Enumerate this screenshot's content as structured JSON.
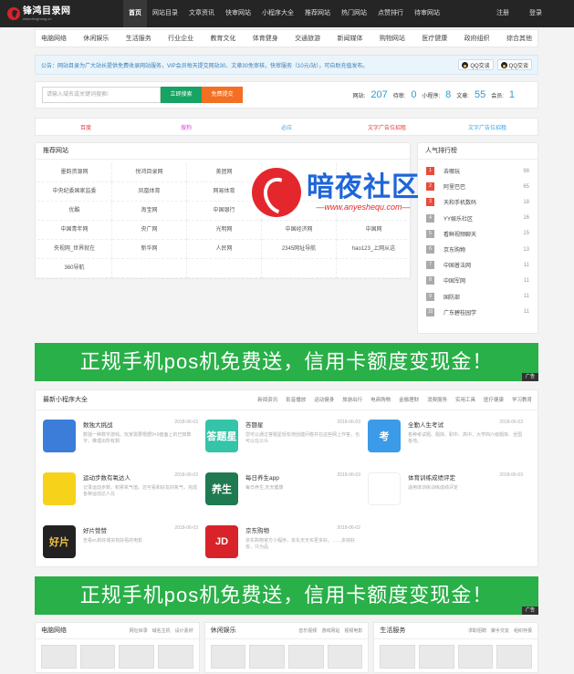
{
  "brand": {
    "name": "锋鸿目录网",
    "slogan": "www.fenghong.cn"
  },
  "nav": {
    "items": [
      "首页",
      "网站目录",
      "文章资讯",
      "快审网站",
      "小程序大全",
      "推荐网站",
      "热门网站",
      "点赞排行",
      "待审网站"
    ],
    "login": "注册",
    "register": "登录"
  },
  "categories": [
    "电脑网络",
    "休闲娱乐",
    "生活服务",
    "行业企业",
    "教育文化",
    "体育健身",
    "交通旅游",
    "新闻媒体",
    "购物网站",
    "医疗健康",
    "政府组织",
    "综合其他"
  ],
  "notice": {
    "text": "公告：网站目录为广大站长提供免费收录网站服务，VIP会员每天提交网站30、文章30免审核，快审服务（10元/站），可自助充值发布。",
    "qq1": "QQ交谈",
    "qq2": "QQ交谈"
  },
  "search": {
    "placeholder": "请输入域名或关键词搜索!",
    "btn_search": "立即搜索",
    "btn_submit": "免费提交"
  },
  "stats": {
    "site_label": "网站:",
    "site_value": "207",
    "pending_label": "待审:",
    "pending_value": "0",
    "app_label": "小程序:",
    "app_value": "8",
    "article_label": "文章:",
    "article_value": "55",
    "member_label": "会员:",
    "member_value": "1"
  },
  "ads": [
    {
      "label": "百度",
      "color": "#e33b3b"
    },
    {
      "label": "搜狗",
      "color": "#d64fd6"
    },
    {
      "label": "必应",
      "color": "#3aa3e0"
    },
    {
      "label": "文字广告位招租",
      "color": "#e33b3b"
    },
    {
      "label": "文字广告位招租",
      "color": "#3aa3e0"
    }
  ],
  "recommend": {
    "title": "推荐网站",
    "sites": [
      "墨韵资源网",
      "悦鸿目录网",
      "美团网",
      "",
      "",
      "中央纪委国家监委",
      "凤凰体育",
      "网易体育",
      "",
      "",
      "优酷",
      "淘宝网",
      "中国银行",
      "",
      "",
      "中国青年网",
      "央广网",
      "光明网",
      "中国经济网",
      "中国网",
      "央视网_世界就在",
      "新华网",
      "人民网",
      "2345网址导航",
      "hao123_上网从这",
      "360导航",
      "",
      "",
      "",
      ""
    ]
  },
  "ranking": {
    "title": "人气排行榜",
    "items": [
      {
        "n": "1",
        "t": "去哪玩",
        "c": "98"
      },
      {
        "n": "2",
        "t": "阿里巴巴",
        "c": "65"
      },
      {
        "n": "3",
        "t": "天和手机数码",
        "c": "18"
      },
      {
        "n": "4",
        "t": "YY娱乐社区",
        "c": "16"
      },
      {
        "n": "5",
        "t": "看鲜视频聊天",
        "c": "15"
      },
      {
        "n": "6",
        "t": "京东购物",
        "c": "13"
      },
      {
        "n": "7",
        "t": "中国普法网",
        "c": "11"
      },
      {
        "n": "8",
        "t": "中国军网",
        "c": "11"
      },
      {
        "n": "9",
        "t": "国防部",
        "c": "11"
      },
      {
        "n": "10",
        "t": "广东碧桂园学",
        "c": "11"
      }
    ]
  },
  "watermark": {
    "title": "暗夜社区",
    "url": "—www.anyeshequ.com—"
  },
  "banner": {
    "text": "正规手机pos机免费送，信用卡额度变现金！",
    "tag": "广告"
  },
  "mini": {
    "title": "最新小程序大全",
    "tabs": [
      "新闻资讯",
      "影音播放",
      "运动健身",
      "旅游出行",
      "电商购物",
      "金融理财",
      "消费服务",
      "实用工具",
      "医疗健康",
      "学习教育"
    ],
    "apps": [
      {
        "name": "数独大挑战",
        "date": "2018-06-03",
        "desc": "数独一种数字游戏。玩家需要根据9×9盘面上的已知数字，推理出所有剩",
        "icon": "#3c7dd9",
        "glyph": ""
      },
      {
        "name": "答题星",
        "date": "2018-06-03",
        "desc": "您可以通过答题星轻松地创建问卷并在这些网上作答，也可以在公众",
        "icon": "#35c4a8",
        "glyph": "答题星"
      },
      {
        "name": "全勤人生考试",
        "date": "2018-06-03",
        "desc": "各种考试题、题库、职中、高中、大学四六级题库、全国各地。",
        "icon": "#3b9be8",
        "glyph": "考"
      },
      {
        "name": "运动步数有氧达人",
        "date": "2018-06-03",
        "desc": "记录运动步数，积累氧气值。还可看和好友的氧气，完成各种运动达人兑",
        "icon": "#f6d21a",
        "glyph": ""
      },
      {
        "name": "每日养生app",
        "date": "2018-06-03",
        "desc": "每日养生,天天健康",
        "icon": "#1f7a52",
        "glyph": "养生"
      },
      {
        "name": "体育训练成绩评定",
        "date": "2018-06-03",
        "desc": "适用体训练训练成绩评定",
        "icon": "#ffffff",
        "glyph": ""
      },
      {
        "name": "好片赞赞",
        "date": "2018-06-03",
        "desc": "告看vr,新好城买有好看的电影",
        "icon": "#222222",
        "glyph": "好片"
      },
      {
        "name": "京东购物",
        "date": "2018-06-02",
        "desc": "京东购物官方小程序，京东天天买更多好。……多快好省，只为品",
        "icon": "#d8232a",
        "glyph": "JD"
      }
    ]
  },
  "panels": [
    {
      "title": "电脑网络",
      "links": [
        "网址目录",
        "域名主机",
        "设计素材"
      ]
    },
    {
      "title": "休闲娱乐",
      "links": [
        "音乐视频",
        "游戏网站",
        "视频电影"
      ]
    },
    {
      "title": "生活服务",
      "links": [
        "求职招聘",
        "聚手交友",
        "组织存报"
      ]
    }
  ]
}
